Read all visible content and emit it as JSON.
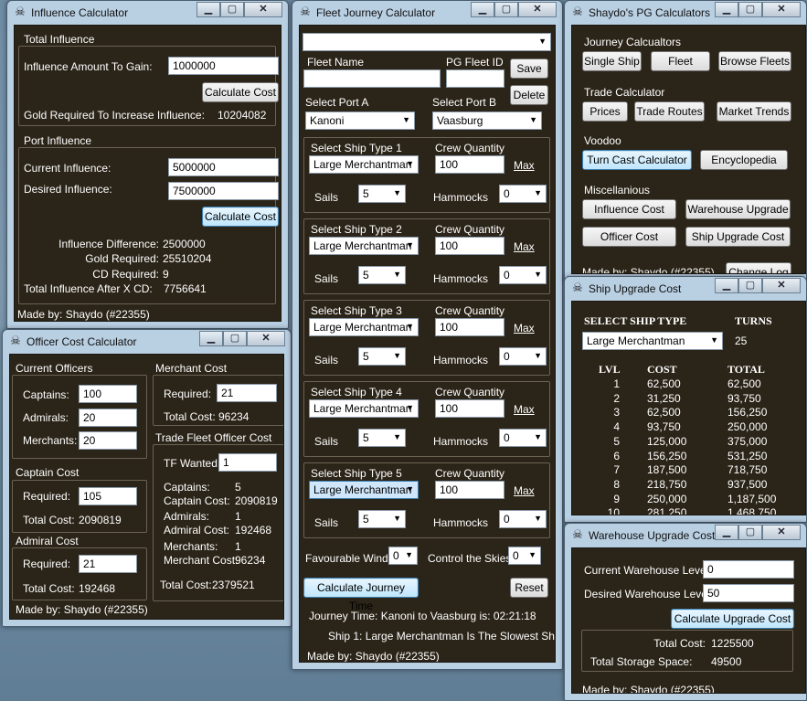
{
  "influence": {
    "title": "Influence Calculator",
    "total_group": "Total Influence",
    "amount_label": "Influence Amount To Gain:",
    "amount_value": "1000000",
    "calc_btn": "Calculate Cost",
    "gold_label": "Gold Required To Increase Influence:",
    "gold_value": "10204082",
    "port_group": "Port Influence",
    "current_label": "Current Influence:",
    "current_value": "5000000",
    "desired_label": "Desired Influence:",
    "desired_value": "7500000",
    "calc_btn2": "Calculate Cost",
    "diff_label": "Influence Difference:",
    "diff_value": "2500000",
    "gold2_label": "Gold Required:",
    "gold2_value": "25510204",
    "cd_label": "CD Required:",
    "cd_value": "9",
    "after_label": "Total Influence After X CD:",
    "after_value": "7756641",
    "made_by": "Made by: Shaydo (#22355)"
  },
  "officer": {
    "title": "Officer Cost Calculator",
    "current_group": "Current Officers",
    "captains_label": "Captains:",
    "captains_value": "100",
    "admirals_label": "Admirals:",
    "admirals_value": "20",
    "merchants_label": "Merchants:",
    "merchants_value": "20",
    "captain_group": "Captain Cost",
    "cap_req_label": "Required:",
    "cap_req_value": "105",
    "cap_total_label": "Total Cost:",
    "cap_total_value": "2090819",
    "admiral_group": "Admiral Cost",
    "adm_req_label": "Required:",
    "adm_req_value": "21",
    "adm_total_label": "Total Cost:",
    "adm_total_value": "192468",
    "merchant_group": "Merchant Cost",
    "mer_req_label": "Required:",
    "mer_req_value": "21",
    "mer_total_label": "Total Cost:",
    "mer_total_value": "96234",
    "tf_group": "Trade Fleet Officer Cost",
    "tf_label": "TF Wanted:",
    "tf_value": "1",
    "tf_captains_label": "Captains:",
    "tf_captains_value": "5",
    "tf_captain_cost_label": "Captain Cost:",
    "tf_captain_cost_value": "2090819",
    "tf_admirals_label": "Admirals:",
    "tf_admirals_value": "1",
    "tf_admiral_cost_label": "Admiral Cost:",
    "tf_admiral_cost_value": "192468",
    "tf_merchants_label": "Merchants:",
    "tf_merchants_value": "1",
    "tf_merchant_cost_label": "Merchant Cost:",
    "tf_merchant_cost_value": "96234",
    "tf_total_label": "Total Cost:",
    "tf_total_value": "2379521",
    "made_by": "Made by: Shaydo (#22355)"
  },
  "fleet": {
    "title": "Fleet Journey Calculator",
    "fleet_name_label": "Fleet Name",
    "pg_fleet_id_label": "PG Fleet ID",
    "save_btn": "Save",
    "delete_btn": "Delete",
    "port_a_label": "Select Port A",
    "port_a_value": "Kanoni",
    "port_b_label": "Select Port B",
    "port_b_value": "Vaasburg",
    "ships": [
      {
        "type_label": "Select Ship Type 1",
        "type_value": "Large Merchantman",
        "crew_label": "Crew Quantity",
        "crew_value": "100",
        "max": "Max",
        "sails_label": "Sails",
        "sails_value": "5",
        "hammocks_label": "Hammocks",
        "hammocks_value": "0"
      },
      {
        "type_label": "Select Ship Type 2",
        "type_value": "Large Merchantman",
        "crew_label": "Crew Quantity",
        "crew_value": "100",
        "max": "Max",
        "sails_label": "Sails",
        "sails_value": "5",
        "hammocks_label": "Hammocks",
        "hammocks_value": "0"
      },
      {
        "type_label": "Select Ship Type 3",
        "type_value": "Large Merchantman",
        "crew_label": "Crew Quantity",
        "crew_value": "100",
        "max": "Max",
        "sails_label": "Sails",
        "sails_value": "5",
        "hammocks_label": "Hammocks",
        "hammocks_value": "0"
      },
      {
        "type_label": "Select Ship Type 4",
        "type_value": "Large Merchantman",
        "crew_label": "Crew Quantity",
        "crew_value": "100",
        "max": "Max",
        "sails_label": "Sails",
        "sails_value": "5",
        "hammocks_label": "Hammocks",
        "hammocks_value": "0"
      },
      {
        "type_label": "Select Ship Type 5",
        "type_value": "Large Merchantman",
        "crew_label": "Crew Quantity",
        "crew_value": "100",
        "max": "Max",
        "sails_label": "Sails",
        "sails_value": "5",
        "hammocks_label": "Hammocks",
        "hammocks_value": "0"
      }
    ],
    "fav_winds_label": "Favourable Winds",
    "fav_winds_value": "0",
    "control_label": "Control the Skies",
    "control_value": "0",
    "calc_btn": "Calculate Journey Time",
    "reset_btn": "Reset",
    "journey_text": "Journey Time:    Kanoni to Vaasburg is: 02:21:18",
    "slowest_text": "Ship 1: Large Merchantman Is The Slowest Ship",
    "made_by": "Made by: Shaydo (#22355)"
  },
  "pg": {
    "title": "Shaydo's PG Calculators",
    "journey_label": "Journey Calcualtors",
    "single_ship": "Single Ship",
    "fleet": "Fleet",
    "browse_fleets": "Browse Fleets",
    "trade_label": "Trade Calculator",
    "prices": "Prices",
    "trade_routes": "Trade Routes",
    "market_trends": "Market Trends",
    "voodoo_label": "Voodoo",
    "turn_cast": "Turn Cast Calculator",
    "encyclopedia": "Encyclopedia",
    "misc_label": "Miscellanious",
    "influence_cost": "Influence Cost",
    "warehouse_upgrade": "Warehouse Upgrade",
    "officer_cost": "Officer Cost",
    "ship_upgrade_cost": "Ship Upgrade Cost",
    "made_by": "Made by: Shaydo (#22355)",
    "change_log": "Change Log"
  },
  "ship_upgrade": {
    "title": "Ship Upgrade Cost",
    "select_label": "SELECT SHIP TYPE",
    "turns_label": "TURNS",
    "ship_value": "Large Merchantman",
    "turns_value": "25",
    "headers": [
      "LVL",
      "COST",
      "TOTAL"
    ],
    "rows": [
      [
        "1",
        "62,500",
        "62,500"
      ],
      [
        "2",
        "31,250",
        "93,750"
      ],
      [
        "3",
        "62,500",
        "156,250"
      ],
      [
        "4",
        "93,750",
        "250,000"
      ],
      [
        "5",
        "125,000",
        "375,000"
      ],
      [
        "6",
        "156,250",
        "531,250"
      ],
      [
        "7",
        "187,500",
        "718,750"
      ],
      [
        "8",
        "218,750",
        "937,500"
      ],
      [
        "9",
        "250,000",
        "1,187,500"
      ],
      [
        "10",
        "281,250",
        "1,468,750"
      ]
    ]
  },
  "warehouse": {
    "title": "Warehouse Upgrade Cost",
    "current_label": "Current Warehouse Level:",
    "current_value": "0",
    "desired_label": "Desired Warehouse Level:",
    "desired_value": "50",
    "calc_btn": "Calculate Upgrade Cost",
    "total_label": "Total Cost:",
    "total_value": "1225500",
    "storage_label": "Total Storage Space:",
    "storage_value": "49500",
    "made_by": "Made by: Shaydo (#22355)"
  }
}
